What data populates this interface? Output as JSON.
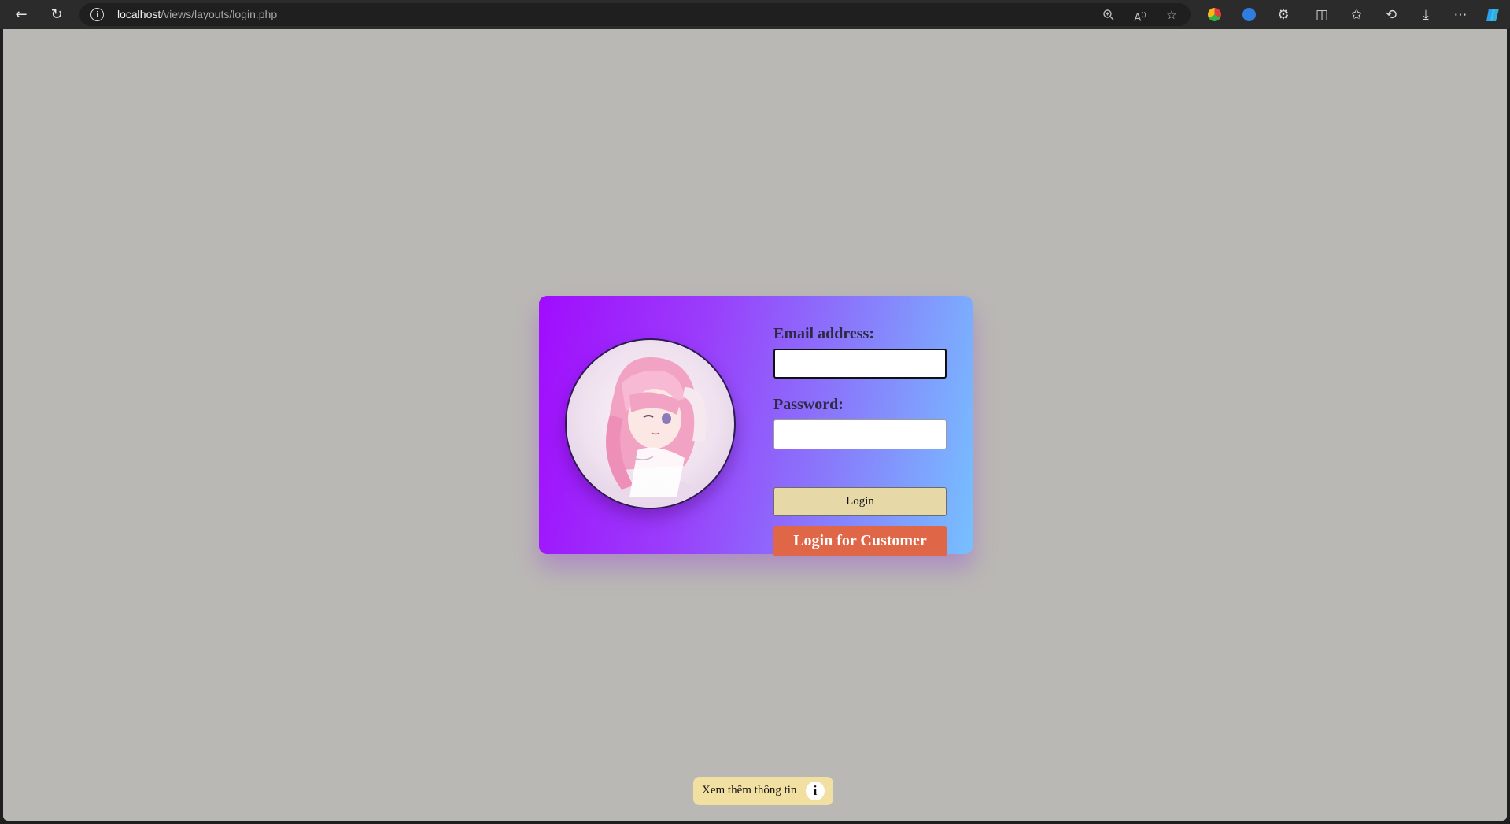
{
  "browser": {
    "url_host": "localhost",
    "url_path": "/views/layouts/login.php",
    "icons": {
      "back": "back-arrow-icon",
      "reload": "reload-icon",
      "site_info": "info-icon",
      "zoom": "zoom-in-icon",
      "read_aloud": "read-aloud-icon",
      "favorite": "star-icon",
      "split_screen": "split-screen-icon",
      "favorites": "favorites-icon",
      "history": "history-icon",
      "downloads": "download-icon",
      "more": "more-icon",
      "copilot": "copilot-icon"
    }
  },
  "login": {
    "email_label": "Email address:",
    "email_value": "",
    "password_label": "Password:",
    "password_value": "",
    "login_button": "Login",
    "customer_button": "Login for Customer",
    "colors": {
      "card_gradient_start": "#a10cfd",
      "card_gradient_end": "#76c0ff",
      "login_button": "#e7d8a8",
      "customer_button": "#df6646"
    }
  },
  "footer": {
    "info_text": "Xem thêm thông tin",
    "info_icon": "i",
    "info_background": "#f2dfa2"
  }
}
